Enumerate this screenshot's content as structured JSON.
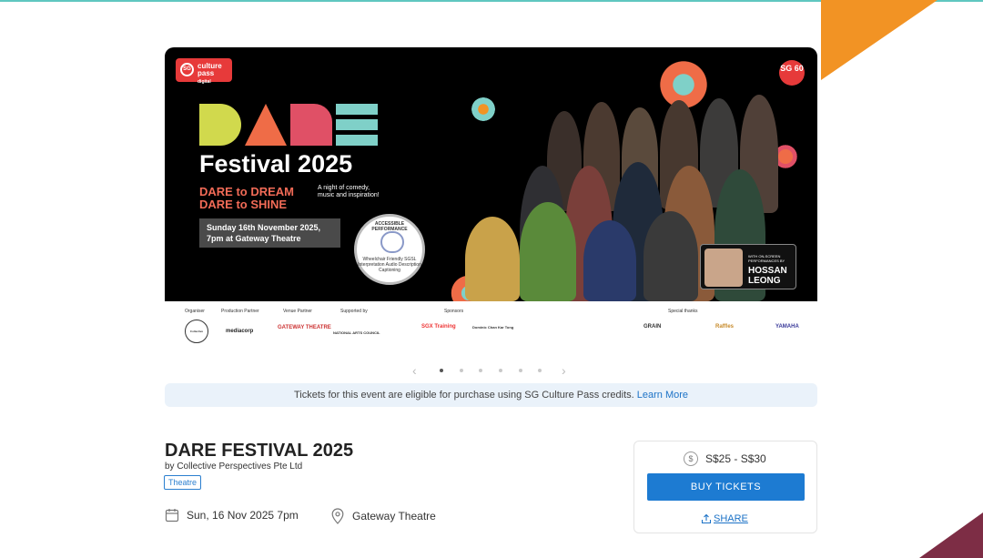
{
  "poster": {
    "cp_logo_text": "culture pass",
    "cp_logo_sub": "digital",
    "sg60": "SG 60",
    "headline_art": "DARE",
    "festival": "Festival 2025",
    "dream_line1": "DARE to DREAM",
    "dream_line2": "DARE to SHINE",
    "tagline": "A night of comedy, music and inspiration!",
    "date_line1": "Sunday 16th November 2025,",
    "date_line2": "7pm at Gateway Theatre",
    "accessible_title": "ACCESSIBLE PERFORMANCE",
    "accessible_sub": "Wheelchair Friendly SGSL Interpretation Audio Description Captioning",
    "hossan_label": "WITH ON-SCREEN PERFORMANCES BY",
    "hossan_name_1": "HOSSAN",
    "hossan_name_2": "LEONG"
  },
  "sponsors": {
    "labels": [
      "Organiser",
      "Production Partner",
      "Venue Partner",
      "Supported by",
      "Sponsors",
      "Special thanks"
    ],
    "logos": [
      "Collective Perspectives",
      "mediacorp",
      "GATEWAY THEATRE",
      "NATIONAL ARTS COUNCIL",
      "SGX Training",
      "Dominic Chan Kar Tong",
      "GRAIN",
      "Raffles",
      "YAMAHA"
    ]
  },
  "carousel": {
    "prev": "‹",
    "next": "›",
    "slides": 6,
    "active_index": 0
  },
  "notice": {
    "text": "Tickets for this event are eligible for purchase using SG Culture Pass credits.",
    "link": "Learn More"
  },
  "event": {
    "title": "DARE FESTIVAL 2025",
    "organizer": "by Collective Perspectives Pte Ltd",
    "tag": "Theatre",
    "date": "Sun, 16 Nov 2025 7pm",
    "venue": "Gateway Theatre"
  },
  "purchase": {
    "price": "S$25 - S$30",
    "currency_icon": "$",
    "buy_label": "BUY TICKETS",
    "share_label": "SHARE"
  },
  "colors": {
    "accent": "#1d7bd2",
    "corner_orange": "#f29324",
    "corner_maroon": "#7d2d45",
    "notice_bg": "#eaf2fa"
  }
}
